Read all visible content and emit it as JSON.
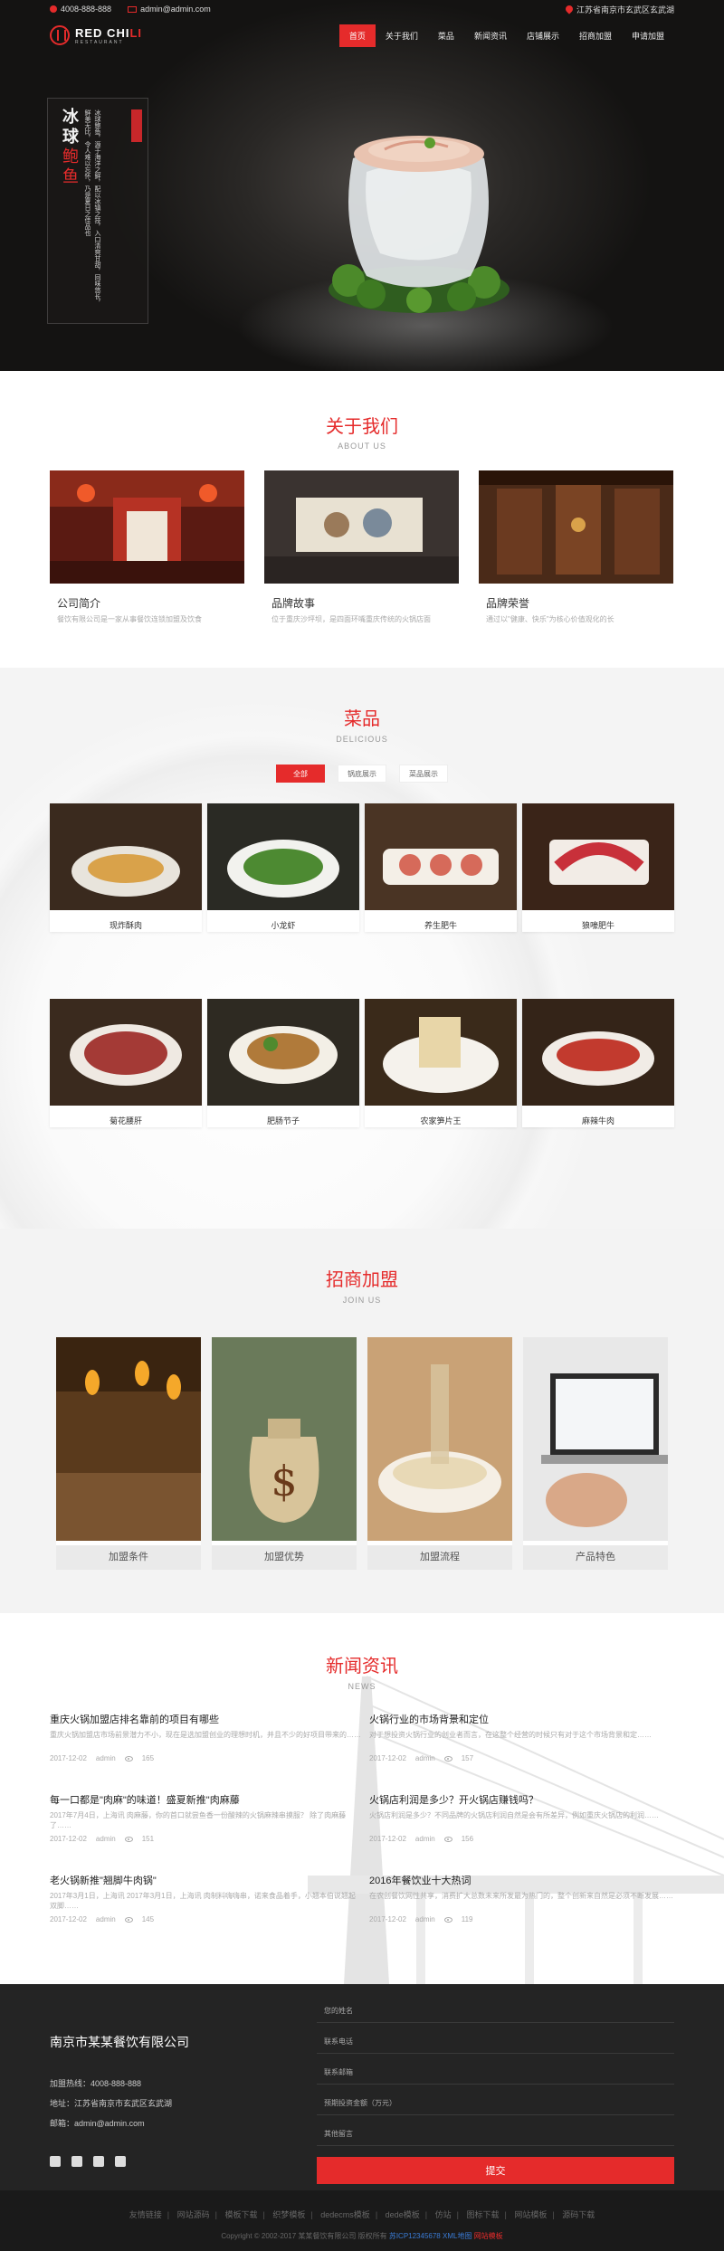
{
  "topbar": {
    "phone": "4008-888-888",
    "email": "admin@admin.com",
    "address": "江苏省南京市玄武区玄武湖"
  },
  "logo": {
    "name_white": "RED CHI",
    "name_red": "LI",
    "subtitle": "RESTAURANT"
  },
  "nav": {
    "items": [
      "首页",
      "关于我们",
      "菜品",
      "新闻资讯",
      "店铺展示",
      "招商加盟",
      "申请加盟"
    ]
  },
  "hero": {
    "title_plain": "冰球",
    "title_red": "鲍鱼",
    "poem": "冰球鲍鱼，源于海洋之鲜，配以冰镇之技，入口清爽甘甜，回味悠长，鲜美无比，令人难以忘怀，乃是夏日之佳品也"
  },
  "about": {
    "title": "关于我们",
    "subtitle": "ABOUT US",
    "cards": [
      {
        "title": "公司简介",
        "desc": "餐饮有限公司是一家从事餐饮连锁加盟及饮食"
      },
      {
        "title": "品牌故事",
        "desc": "位于重庆沙坪坝，是四面环嘴重庆传统的火锅店面"
      },
      {
        "title": "品牌荣誉",
        "desc": "通过以\"健康、快乐\"为核心价值观化的长"
      }
    ]
  },
  "dishes": {
    "title": "菜品",
    "subtitle": "DELICIOUS",
    "tabs": [
      "全部",
      "锅底展示",
      "菜品展示"
    ],
    "items": [
      "现炸酥肉",
      "小龙虾",
      "养生肥牛",
      "狼嚎肥牛",
      "菊花腰肝",
      "肥肠节子",
      "农家笋片王",
      "麻辣牛肉"
    ]
  },
  "join": {
    "title": "招商加盟",
    "subtitle": "JOIN US",
    "cards": [
      "加盟条件",
      "加盟优势",
      "加盟流程",
      "产品特色"
    ]
  },
  "news": {
    "title": "新闻资讯",
    "subtitle": "NEWS",
    "items": [
      {
        "title": "重庆火锅加盟店排名靠前的项目有哪些",
        "desc": "重庆火锅加盟店市场前景潜力不小，现在是选加盟创业的理想时机，并且不少的好项目带来的……",
        "date": "2017-12-02",
        "author": "admin",
        "views": "165"
      },
      {
        "title": "火锅行业的市场背景和定位",
        "desc": "对于想投资火锅行业的创业者而言，在这整个经营的时候只有对于这个市场背景和定……",
        "date": "2017-12-02",
        "author": "admin",
        "views": "157"
      },
      {
        "title": "每一口都是\"肉麻\"的味道！盛夏新推\"肉麻藤",
        "desc": "2017年7月4日，上海讯 肉麻藤，你的首口就尝鱼香一份酸辣的火锅麻辣串摸服？ 除了肉麻藤了……",
        "date": "2017-12-02",
        "author": "admin",
        "views": "151"
      },
      {
        "title": "火锅店利润是多少？开火锅店赚钱吗？",
        "desc": "火锅店利润是多少？不同品牌的火锅店利润自然是会有所差异，例如重庆火锅店的利润……",
        "date": "2017-12-02",
        "author": "admin",
        "views": "156"
      },
      {
        "title": "老火锅新推\"翘脚牛肉锅\"",
        "desc": "2017年3月1日，上海讯 2017年3月1日，上海讯 肉制料嗨嗨串，诺来食品着手，小翘本伯说翘起双脚……",
        "date": "2017-12-02",
        "author": "admin",
        "views": "145"
      },
      {
        "title": "2016年餐饮业十大热词",
        "desc": "在农创餐饮网性共享，消费扩大总数未来所发最为热门的，整个创新来自然是必须不断发展……",
        "date": "2017-12-02",
        "author": "admin",
        "views": "119"
      }
    ]
  },
  "footer": {
    "company": "南京市某某餐饮有限公司",
    "hotline": "加盟热线：4008-888-888",
    "address": "地址：江苏省南京市玄武区玄武湖",
    "email": "邮箱：admin@admin.com",
    "fields": [
      "您的姓名",
      "联系电话",
      "联系邮箱",
      "预期投资金额（万元）",
      "其他留言"
    ],
    "submit": "提交",
    "links_label": "友情链接",
    "links": [
      "网站源码",
      "模板下载",
      "织梦模板",
      "dedecms模板",
      "dede模板",
      "仿站",
      "图标下载",
      "网站模板",
      "源码下载"
    ],
    "copyright": "Copyright © 2002-2017 某某餐饮有限公司 版权所有",
    "icp": "苏ICP12345678",
    "xml_map": "XML地图",
    "cms": "网站模板"
  },
  "colors": {
    "accent": "#e52b2b",
    "footer_bg": "#242424"
  }
}
